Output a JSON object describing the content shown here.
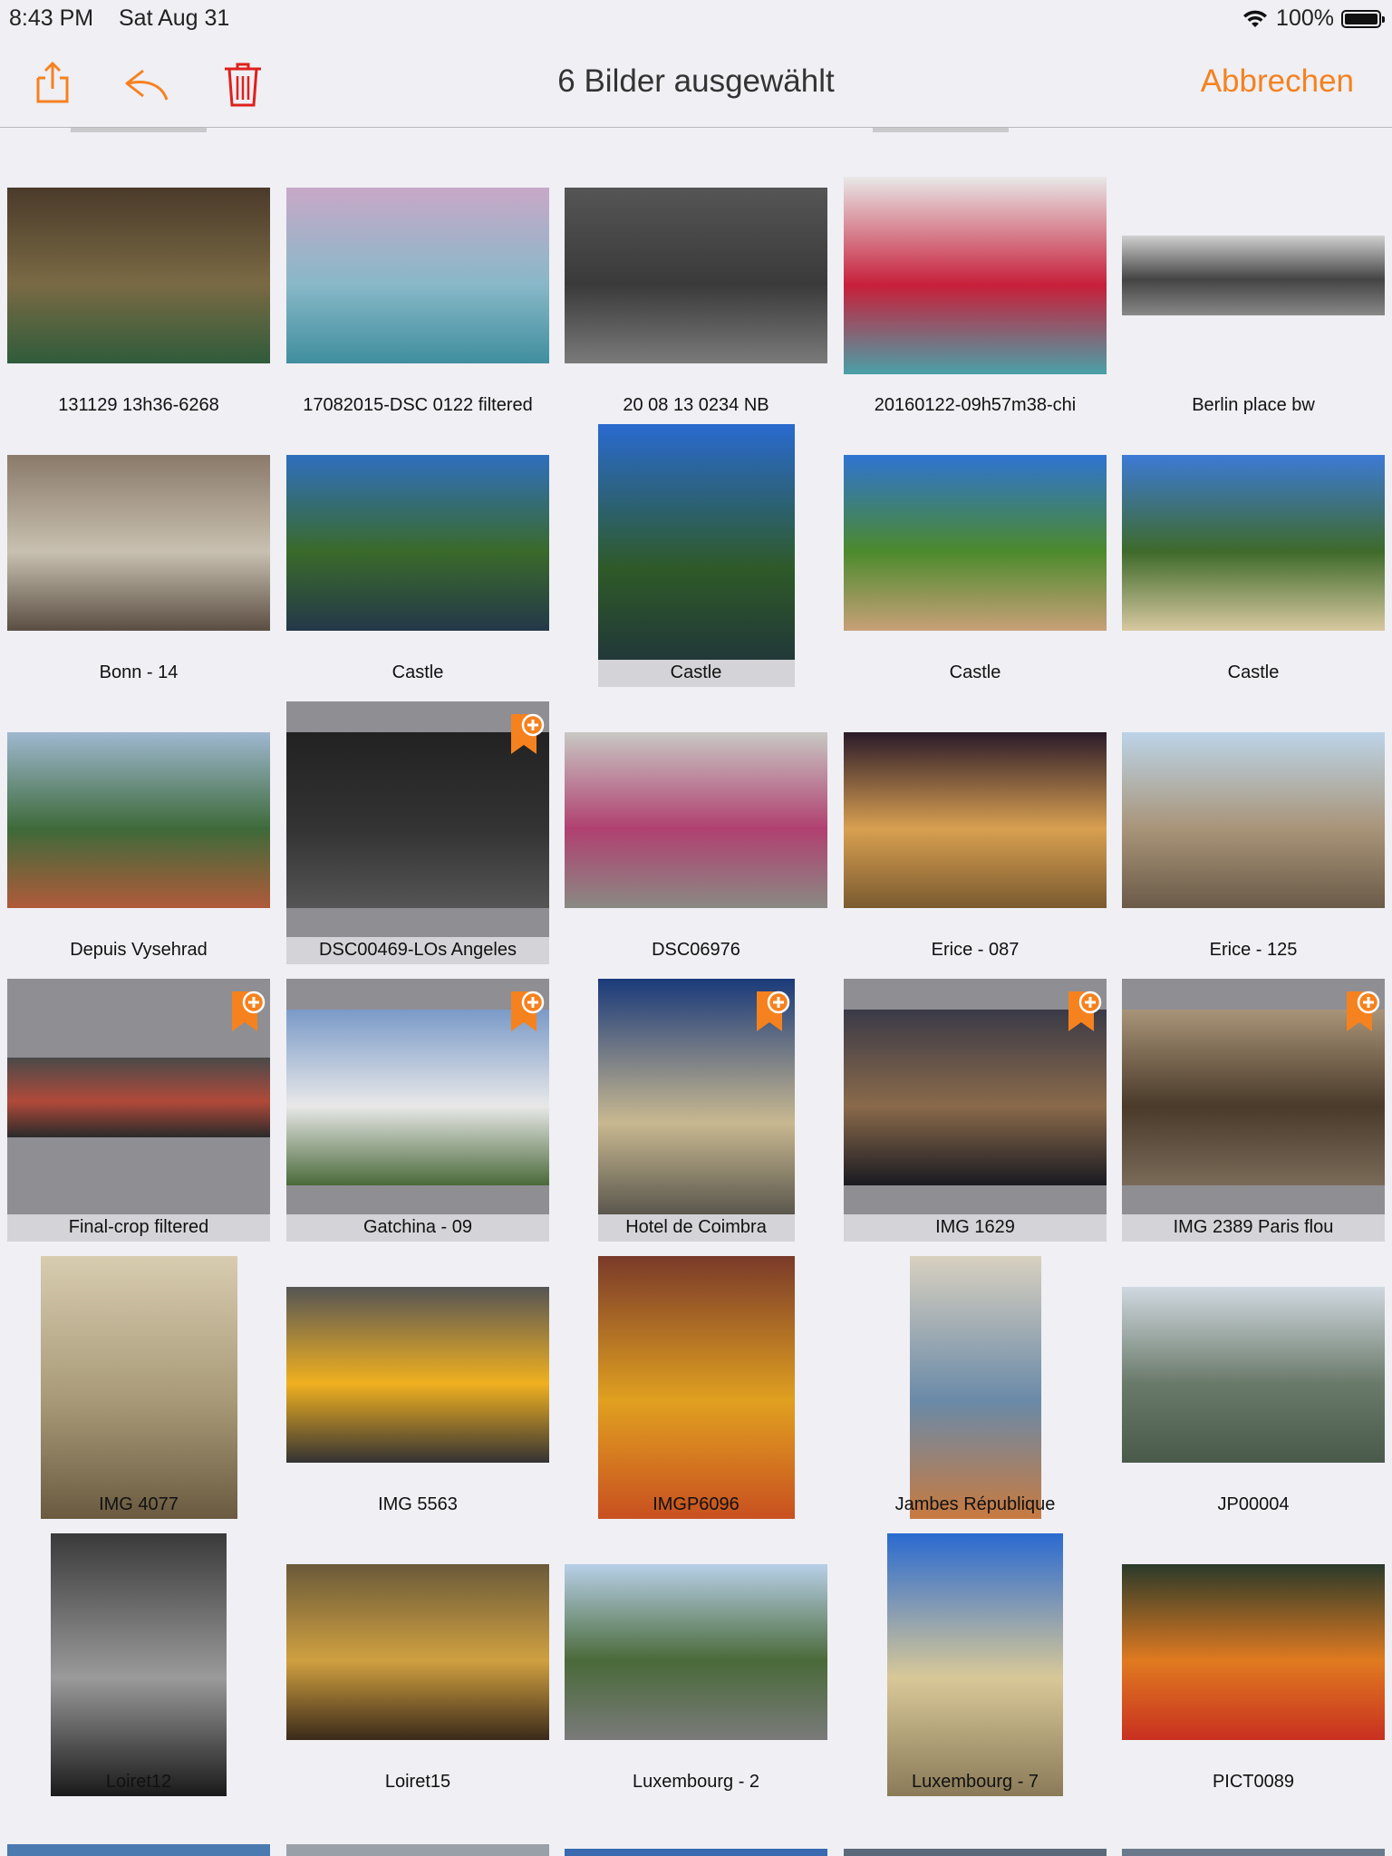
{
  "status": {
    "time": "8:43 PM",
    "date": "Sat Aug 31",
    "battery": "100%"
  },
  "toolbar": {
    "title": "6 Bilder ausgewählt",
    "cancel_label": "Abbrechen",
    "accent": "#f5821f"
  },
  "photos": [
    {
      "label": "131129 13h36-6268",
      "shape": "landscape",
      "selected": false,
      "colors": [
        "#4a3a2a",
        "#7a6a44",
        "#2f5b3a"
      ]
    },
    {
      "label": "17082015-DSC 0122 filtered",
      "shape": "landscape",
      "selected": false,
      "colors": [
        "#c8a8c8",
        "#88b8c8",
        "#3f8e9e"
      ]
    },
    {
      "label": "20 08 13 0234 NB",
      "shape": "landscape",
      "selected": false,
      "colors": [
        "#555555",
        "#3a3a3a",
        "#7a7a7a"
      ]
    },
    {
      "label": "20160122-09h57m38-chi",
      "shape": "square-ish",
      "selected": false,
      "colors": [
        "#e8e8e8",
        "#c71f3a",
        "#4aa0a8"
      ]
    },
    {
      "label": "Berlin place bw",
      "shape": "panorama",
      "selected": false,
      "colors": [
        "#d0d0d0",
        "#444444",
        "#888888"
      ]
    },
    {
      "label": "Bonn - 14",
      "shape": "landscape",
      "selected": false,
      "colors": [
        "#8a7a6a",
        "#c8c0b0",
        "#5a4e42"
      ]
    },
    {
      "label": "Castle",
      "shape": "landscape",
      "selected": false,
      "colors": [
        "#2f6fbf",
        "#3a6a2a",
        "#24384a"
      ]
    },
    {
      "label": "Castle",
      "shape": "portrait",
      "selected": true,
      "colors": [
        "#2a6ad0",
        "#2e5a28",
        "#1e2e3e"
      ]
    },
    {
      "label": "Castle",
      "shape": "landscape",
      "selected": false,
      "colors": [
        "#2f74d2",
        "#4c8a2c",
        "#c8a078"
      ]
    },
    {
      "label": "Castle",
      "shape": "landscape",
      "selected": false,
      "colors": [
        "#3d7ad6",
        "#3e6a2a",
        "#d8c8a0"
      ]
    },
    {
      "label": "Depuis Vysehrad",
      "shape": "landscape",
      "selected": false,
      "colors": [
        "#9fb8d0",
        "#3e6a3a",
        "#b05a3a"
      ]
    },
    {
      "label": "DSC00469-LOs Angeles",
      "shape": "landscape",
      "selected": true,
      "bookmark": true,
      "colors": [
        "#222222",
        "#333333",
        "#555555"
      ]
    },
    {
      "label": "DSC06976",
      "shape": "landscape",
      "selected": false,
      "colors": [
        "#c8c8c4",
        "#b04070",
        "#8a8a84"
      ]
    },
    {
      "label": "Erice - 087",
      "shape": "landscape",
      "selected": false,
      "colors": [
        "#2a1a2a",
        "#d8a050",
        "#7a5a30"
      ]
    },
    {
      "label": "Erice - 125",
      "shape": "landscape",
      "selected": false,
      "colors": [
        "#bcd4e8",
        "#a89478",
        "#6a5a48"
      ]
    },
    {
      "label": "Final-crop filtered",
      "shape": "panorama",
      "selected": true,
      "bookmark": true,
      "colors": [
        "#4a4a4a",
        "#b04a3a",
        "#2a2a2a"
      ]
    },
    {
      "label": "Gatchina - 09",
      "shape": "landscape",
      "selected": true,
      "bookmark": true,
      "colors": [
        "#7a9ac8",
        "#e8e8e8",
        "#4a6a3a"
      ]
    },
    {
      "label": "Hotel de Coimbra",
      "shape": "portrait",
      "selected": true,
      "bookmark": true,
      "colors": [
        "#1a3a7a",
        "#c8b890",
        "#3a3a3a"
      ]
    },
    {
      "label": "IMG 1629",
      "shape": "landscape",
      "selected": true,
      "bookmark": true,
      "colors": [
        "#3a3a48",
        "#8a6a4a",
        "#1a1a22"
      ]
    },
    {
      "label": "IMG 2389 Paris flou",
      "shape": "landscape",
      "selected": true,
      "bookmark": true,
      "colors": [
        "#a89478",
        "#4a3a2a",
        "#7a6a58"
      ]
    },
    {
      "label": "IMG 4077",
      "shape": "portrait",
      "selected": false,
      "colors": [
        "#d8ccb0",
        "#a89a78",
        "#6a5a40"
      ]
    },
    {
      "label": "IMG 5563",
      "shape": "landscape",
      "selected": false,
      "colors": [
        "#555555",
        "#f0b020",
        "#333333"
      ]
    },
    {
      "label": "IMGP6096",
      "shape": "portrait",
      "selected": false,
      "colors": [
        "#7a3a2a",
        "#e0a020",
        "#c85020"
      ]
    },
    {
      "label": "Jambes République",
      "shape": "tall",
      "selected": false,
      "colors": [
        "#d8d0c0",
        "#6a8aa8",
        "#c87a40"
      ]
    },
    {
      "label": "JP00004",
      "shape": "landscape",
      "selected": false,
      "colors": [
        "#d0d8e0",
        "#6a7a6a",
        "#4a5a4a"
      ]
    },
    {
      "label": "Loiret12",
      "shape": "tall-portrait",
      "selected": false,
      "colors": [
        "#3a3a3a",
        "#9a9a9a",
        "#1a1a1a"
      ]
    },
    {
      "label": "Loiret15",
      "shape": "landscape",
      "selected": false,
      "colors": [
        "#6a5a3a",
        "#d0a040",
        "#3a2a1a"
      ]
    },
    {
      "label": "Luxembourg - 2",
      "shape": "landscape",
      "selected": false,
      "colors": [
        "#b8d0e8",
        "#4a6a3a",
        "#7a7a7a"
      ]
    },
    {
      "label": "Luxembourg - 7",
      "shape": "tall-portrait",
      "selected": false,
      "colors": [
        "#2a6ad0",
        "#d8c898",
        "#8a7a58"
      ]
    },
    {
      "label": "PICT0089",
      "shape": "landscape",
      "selected": false,
      "colors": [
        "#2a3a2a",
        "#e07a20",
        "#c83020"
      ]
    }
  ]
}
